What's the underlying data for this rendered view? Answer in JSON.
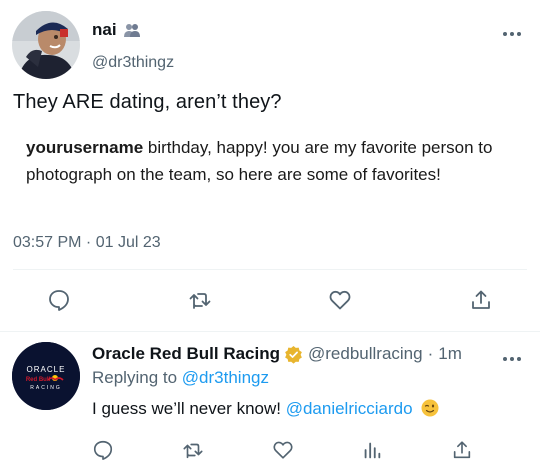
{
  "tweet": {
    "author_name": "nai",
    "author_badge_icon": "people-icon",
    "author_handle": "@dr3thingz",
    "text": "They ARE dating, aren’t they?",
    "quote_username": "yourusername",
    "quote_text": " birthday, happy! you are my favorite person to photograph on the team, so here are some of favorites!",
    "timestamp": "03:57 PM · 01 Jul 23",
    "more_icon": "more-icon",
    "actions": [
      "reply-icon",
      "retweet-icon",
      "like-icon",
      "share-icon"
    ]
  },
  "reply": {
    "author_name": "Oracle Red Bull Racing",
    "verified_icon": "verified-badge-icon",
    "author_handle": "@redbullracing",
    "separator": "·",
    "time": "1m",
    "replying_prefix": "Replying to ",
    "replying_to": "@dr3thingz",
    "text_before": "I guess we’ll never know! ",
    "mention": "@danielricciardo",
    "emoji_icon": "wink-emoji-icon",
    "avatar_text": {
      "line1": "ORACLE",
      "line2": "Red Bull",
      "line3": "RACING"
    },
    "actions": [
      "reply-icon",
      "retweet-icon",
      "like-icon",
      "stats-icon",
      "share-icon"
    ]
  },
  "colors": {
    "text": "#0f1419",
    "muted": "#536471",
    "link": "#1d9bf0",
    "verified": "#e8b52e",
    "divider": "#eff3f4",
    "redbull_bg": "#0a1230"
  }
}
